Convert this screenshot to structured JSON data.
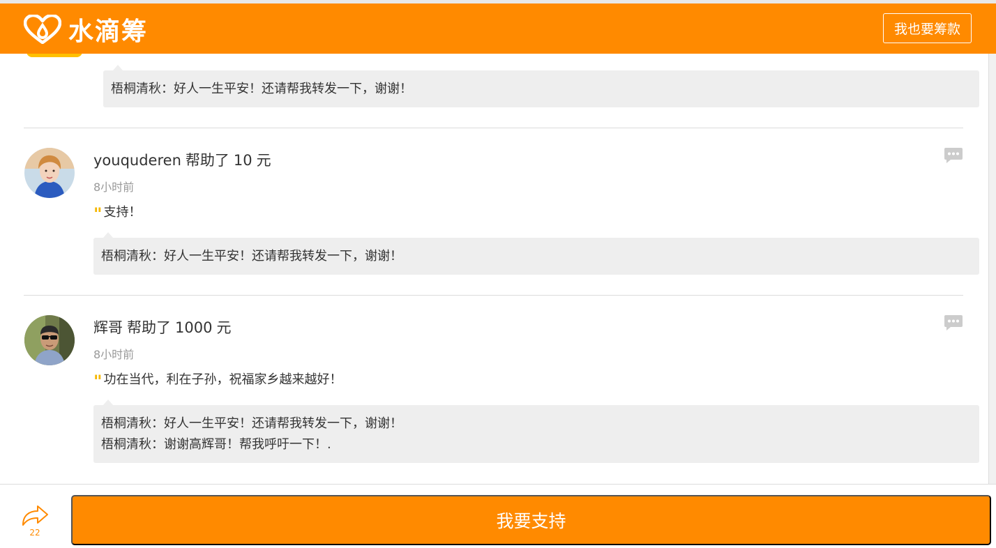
{
  "header": {
    "logo_text": "水滴筹",
    "raise_button": "我也要筹款",
    "brand_color": "#ff8a00"
  },
  "feed": {
    "previous_entry_reply": {
      "lines": [
        {
          "author": "梧桐清秋",
          "text": "：好人一生平安！还请帮我转发一下，谢谢！"
        }
      ]
    },
    "entries": [
      {
        "name": "youquderen",
        "action": "帮助了",
        "amount": "10",
        "unit": "元",
        "time": "8小时前",
        "message": "支持！",
        "replies": [
          {
            "author": "梧桐清秋",
            "text": "：好人一生平安！还请帮我转发一下，谢谢！"
          }
        ]
      },
      {
        "name": "辉哥",
        "action": "帮助了",
        "amount": "1000",
        "unit": "元",
        "time": "8小时前",
        "message": "功在当代，利在子孙，祝福家乡越来越好！",
        "replies": [
          {
            "author": "梧桐清秋",
            "text": "：好人一生平安！还请帮我转发一下，谢谢！"
          },
          {
            "author": "梧桐清秋",
            "text": "：谢谢高辉哥！帮我呼吁一下！."
          }
        ]
      }
    ]
  },
  "bottom_bar": {
    "share_count": "22",
    "support_button": "我要支持"
  },
  "icons": {
    "logo": "heart-drop-logo-icon",
    "share": "share-arrow-icon",
    "comment": "speech-bubble-icon",
    "quote": "quote-mark-icon"
  }
}
